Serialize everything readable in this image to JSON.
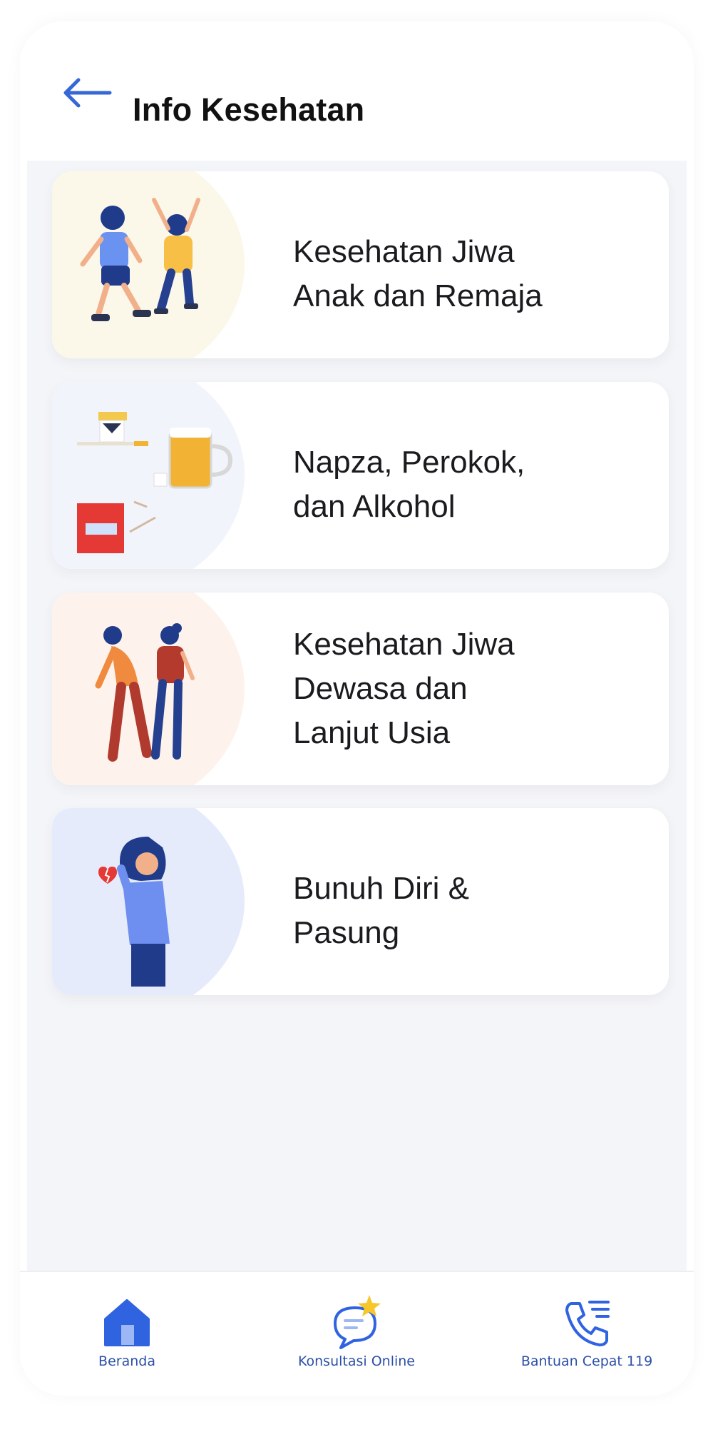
{
  "header": {
    "back_icon": "arrow-left-icon",
    "title": "Info Kesehatan"
  },
  "cards": [
    {
      "title": "Kesehatan Jiwa\nAnak dan Remaja",
      "illustration": "children-playing-illustration"
    },
    {
      "title": "Napza, Perokok,\ndan Alkohol",
      "illustration": "cigarette-beer-pills-illustration"
    },
    {
      "title": "Kesehatan Jiwa\nDewasa dan\nLanjut Usia",
      "illustration": "elderly-couple-illustration"
    },
    {
      "title": "Bunuh Diri &\nPasung",
      "illustration": "sad-woman-illustration"
    }
  ],
  "bottom_nav": {
    "home": {
      "label": "Beranda",
      "icon": "home-icon"
    },
    "consult": {
      "label": "Konsultasi Online",
      "icon": "chat-star-icon"
    },
    "emergency": {
      "label": "Bantuan Cepat 119",
      "icon": "phone-call-icon"
    }
  },
  "colors": {
    "accent": "#3567d6",
    "background": "#f4f5f8",
    "card": "#ffffff",
    "text": "#1b1b1f"
  }
}
